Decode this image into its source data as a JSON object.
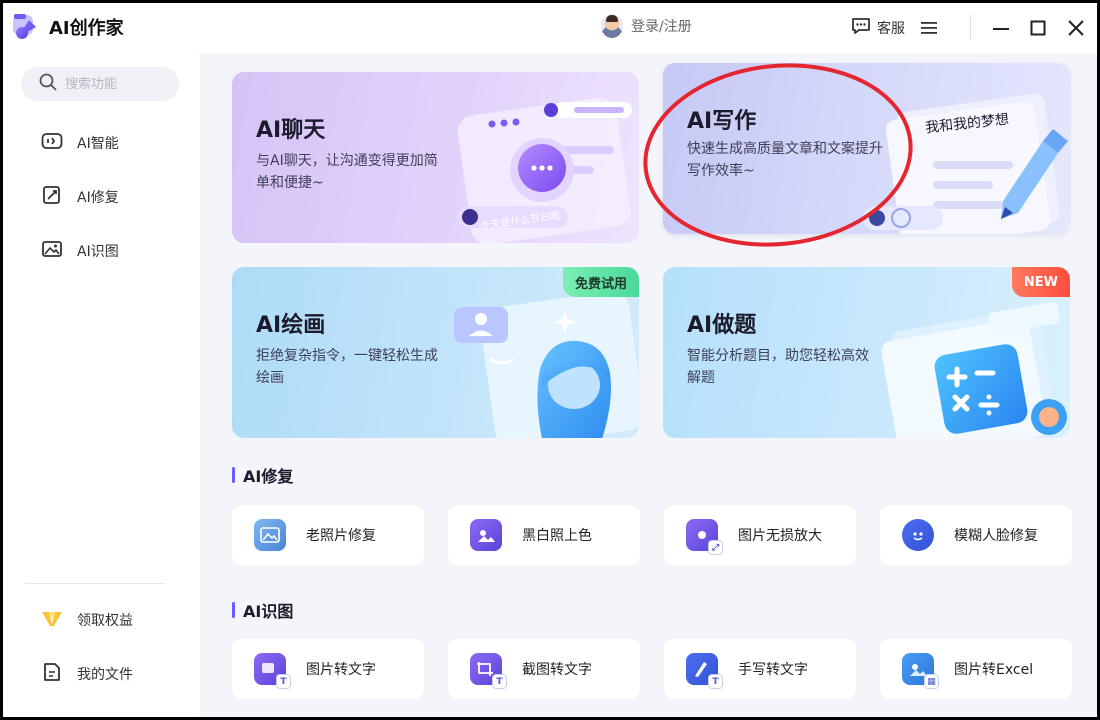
{
  "app": {
    "title": "AI创作家"
  },
  "header": {
    "login_label": "登录/注册",
    "service_label": "客服"
  },
  "sidebar": {
    "search_placeholder": "搜索功能",
    "items": [
      {
        "label": "AI智能",
        "icon": "ai-smart-icon"
      },
      {
        "label": "AI修复",
        "icon": "repair-icon"
      },
      {
        "label": "AI识图",
        "icon": "image-recognize-icon"
      }
    ],
    "bottom_items": [
      {
        "label": "领取权益",
        "icon": "benefits-icon"
      },
      {
        "label": "我的文件",
        "icon": "file-icon"
      }
    ]
  },
  "feature_cards": {
    "chat": {
      "title": "AI聊天",
      "desc": "与AI聊天，让沟通变得更加简单和便捷~",
      "bubble": "今天是什么节日呢"
    },
    "write": {
      "title": "AI写作",
      "desc": "快速生成高质量文章和文案提升写作效率~",
      "paper_text": "我和我的梦想"
    },
    "draw": {
      "title": "AI绘画",
      "desc": "拒绝复杂指令，一键轻松生成绘画",
      "badge": "免费试用"
    },
    "quiz": {
      "title": "AI做题",
      "desc": "智能分析题目，助您轻松高效解题",
      "badge": "NEW"
    }
  },
  "sections": {
    "repair": {
      "title": "AI修复",
      "tools": [
        {
          "label": "老照片修复"
        },
        {
          "label": "黑白照上色"
        },
        {
          "label": "图片无损放大"
        },
        {
          "label": "模糊人脸修复"
        }
      ]
    },
    "recognize": {
      "title": "AI识图",
      "tools": [
        {
          "label": "图片转文字"
        },
        {
          "label": "截图转文字"
        },
        {
          "label": "手写转文字"
        },
        {
          "label": "图片转Excel"
        }
      ]
    }
  },
  "colors": {
    "accent": "#6a5cff",
    "highlight_circle": "#e32630"
  }
}
